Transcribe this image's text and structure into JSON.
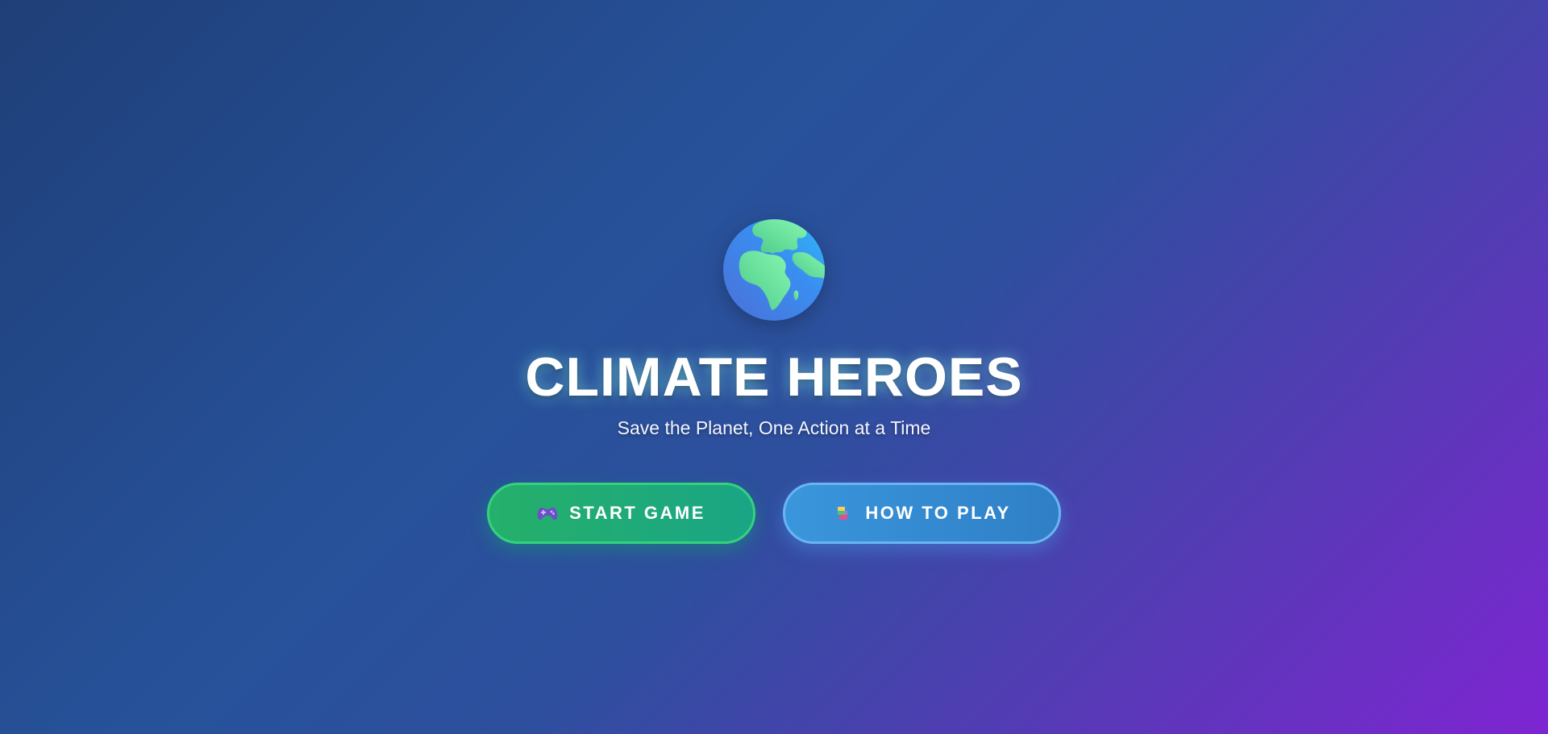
{
  "title": "CLIMATE HEROES",
  "subtitle": "Save the Planet, One Action at a Time",
  "logo_icon": "globe-europe-africa-icon",
  "buttons": {
    "start": {
      "label": "START GAME",
      "icon": "game-controller-icon",
      "color": "#25b06a"
    },
    "how_to_play": {
      "label": "HOW TO PLAY",
      "icon": "books-icon",
      "color": "#3a96dc"
    }
  },
  "colors": {
    "background_start": "#1f3f78",
    "background_end": "#7e25d2",
    "title_glow": "#8cffe6"
  }
}
